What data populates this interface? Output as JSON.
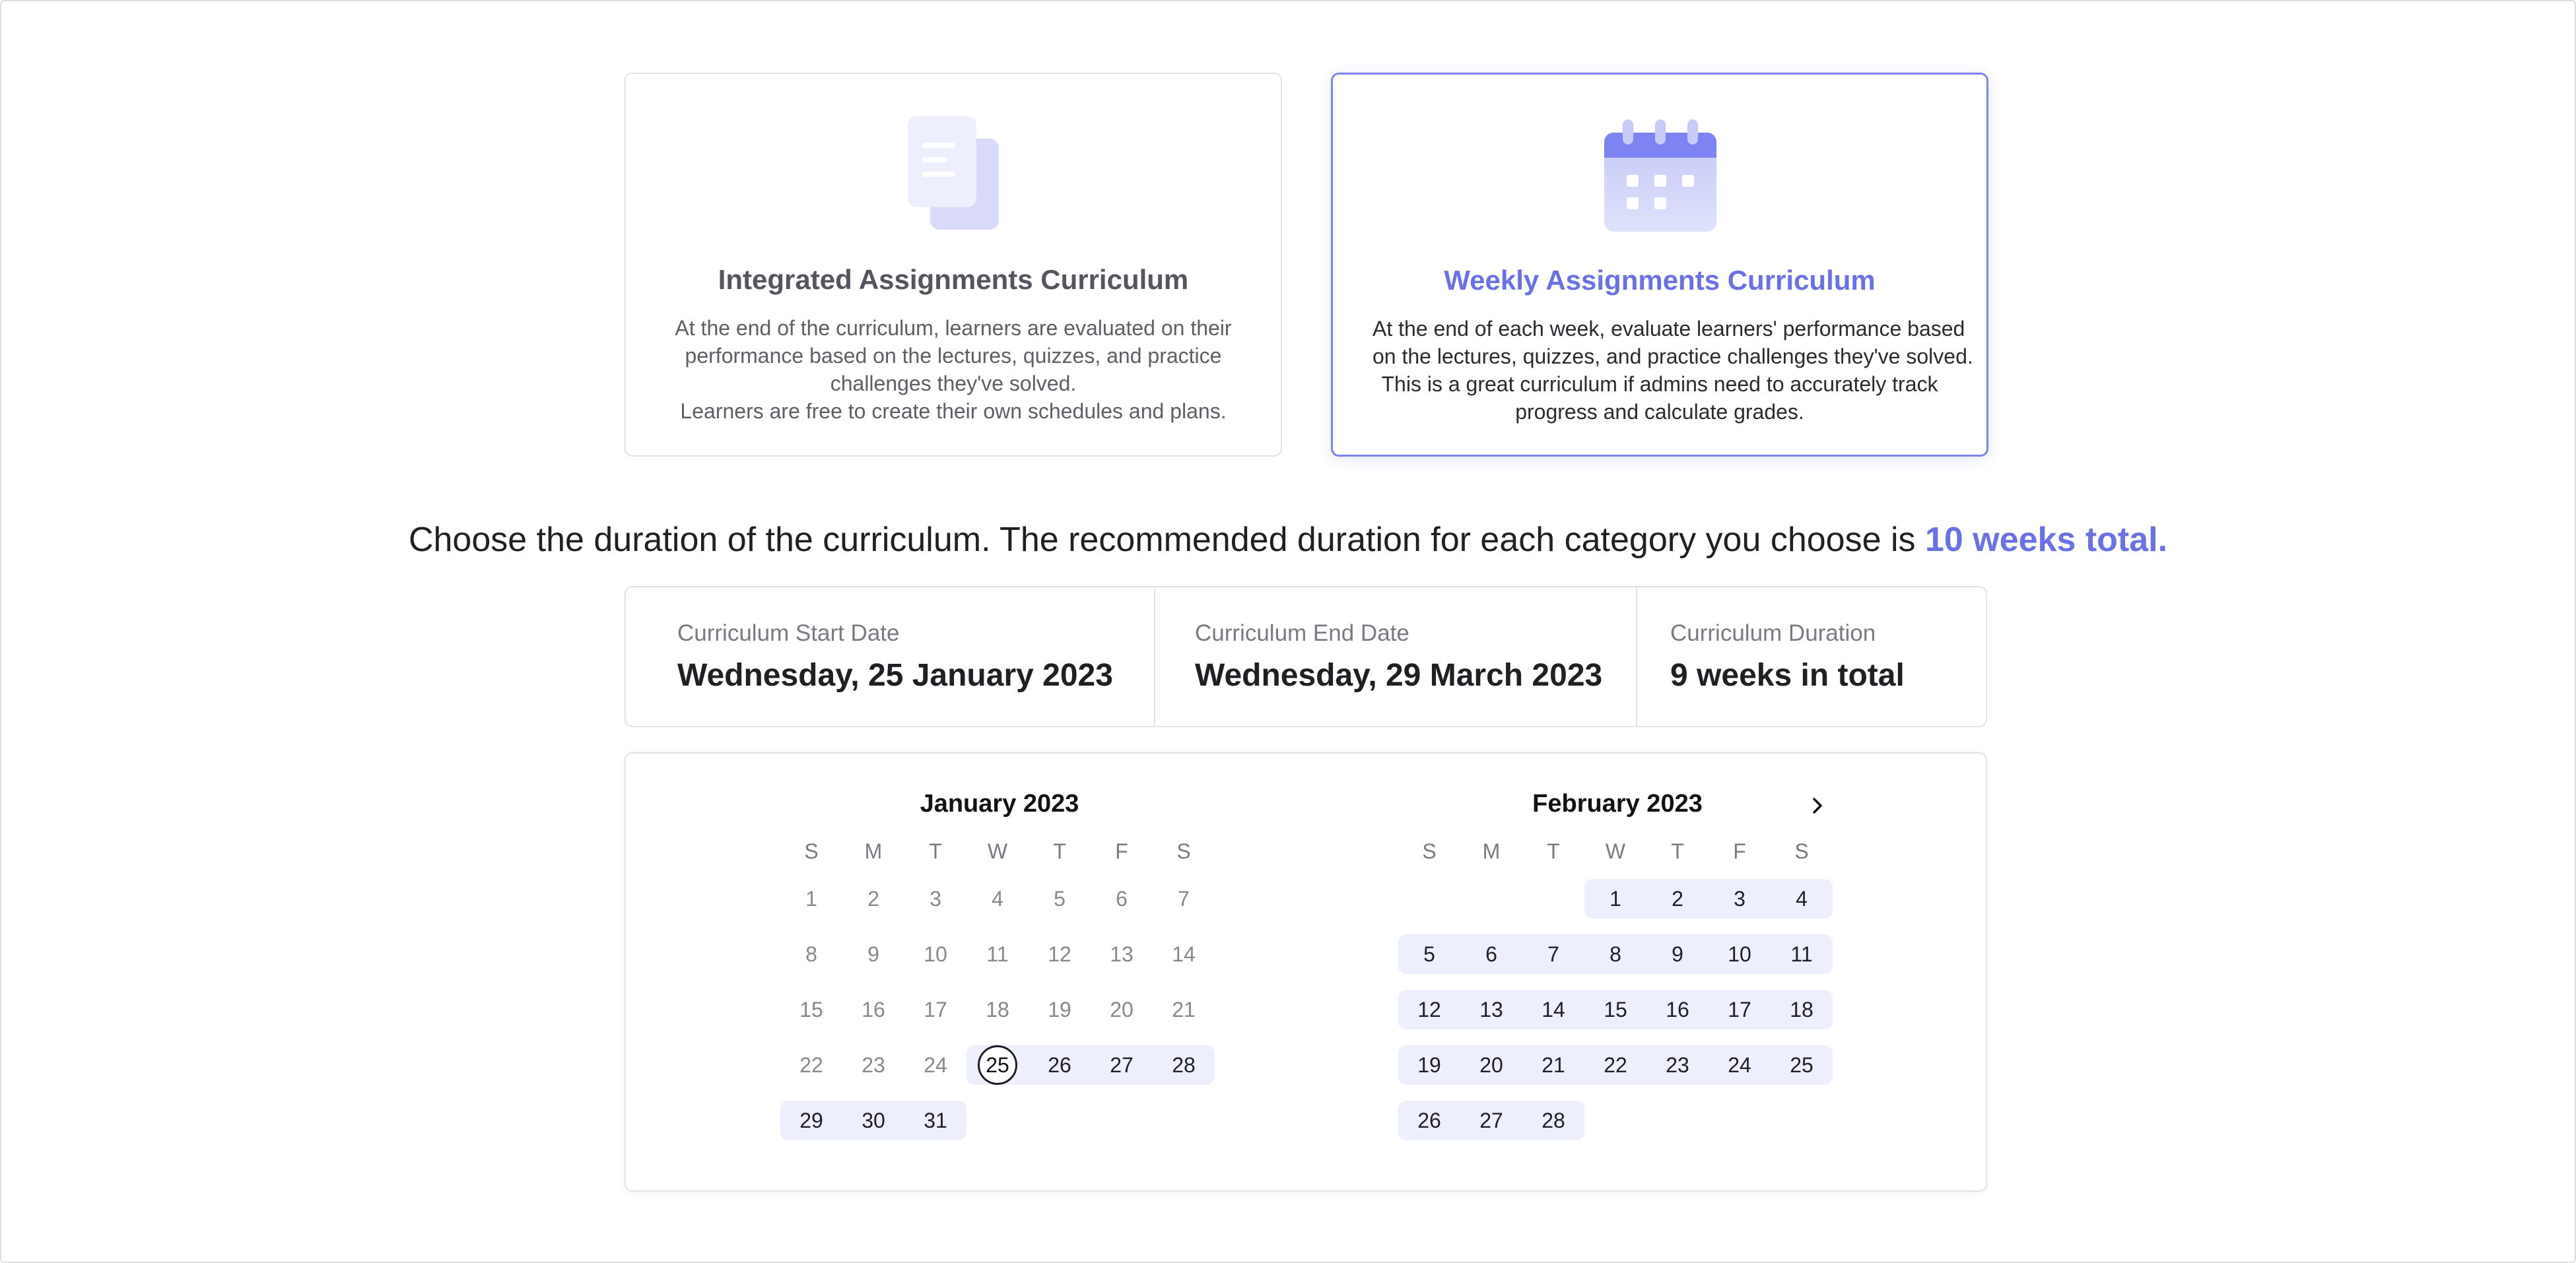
{
  "cards": [
    {
      "id": "integrated",
      "title": "Integrated Assignments Curriculum",
      "description_lines": [
        "At the end of the curriculum, learners are evaluated on their",
        "performance based on the lectures, quizzes, and practice",
        "challenges they've solved.",
        "Learners are free to create their own schedules and plans."
      ],
      "icon": "documents-icon",
      "selected": false
    },
    {
      "id": "weekly",
      "title": "Weekly Assignments Curriculum",
      "description_lines": [
        "At the end of each week, evaluate learners' performance based",
        "on the lectures, quizzes, and practice challenges they've solved.",
        "This is a great curriculum if admins need to accurately track",
        "progress and calculate grades."
      ],
      "icon": "calendar-icon",
      "selected": true
    }
  ],
  "headline": {
    "text": "Choose the duration of the curriculum. The recommended duration for each category you choose is ",
    "accent": "10 weeks total."
  },
  "summary": {
    "start_label": "Curriculum Start Date",
    "start_value": "Wednesday, 25 January 2023",
    "end_label": "Curriculum End Date",
    "end_value": "Wednesday, 29 March 2023",
    "duration_label": "Curriculum Duration",
    "duration_value": "9 weeks in total"
  },
  "calendar": {
    "weekday_headers": [
      "S",
      "M",
      "T",
      "W",
      "T",
      "F",
      "S"
    ],
    "next_icon": "chevron-right-icon",
    "months": [
      {
        "title": "January 2023",
        "first_weekday": 0,
        "days_in_month": 31,
        "range_start": 25,
        "range_end": 31,
        "selected_day": 25
      },
      {
        "title": "February 2023",
        "first_weekday": 3,
        "days_in_month": 28,
        "range_start": 1,
        "range_end": 28,
        "selected_day": null
      }
    ]
  },
  "colors": {
    "accent": "#6a70e6",
    "range_fill": "#eeeffd",
    "border": "#e3e3e8"
  }
}
